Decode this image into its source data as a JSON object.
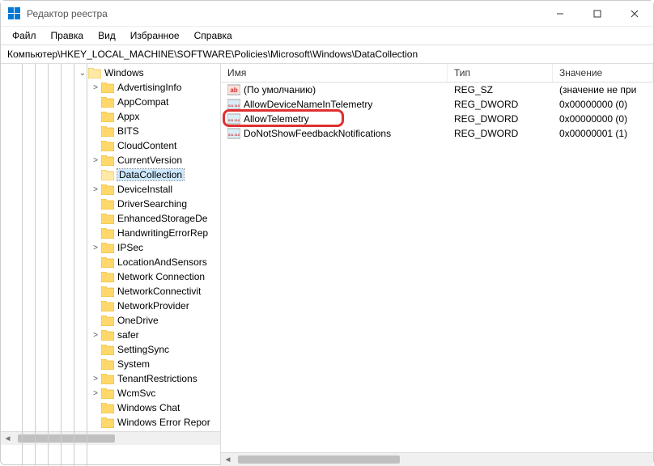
{
  "window": {
    "title": "Редактор реестра"
  },
  "menu": {
    "file": "Файл",
    "edit": "Правка",
    "view": "Вид",
    "favorites": "Избранное",
    "help": "Справка"
  },
  "address": {
    "path": "Компьютер\\HKEY_LOCAL_MACHINE\\SOFTWARE\\Policies\\Microsoft\\Windows\\DataCollection"
  },
  "tree": {
    "parent": {
      "label": "Windows",
      "expanded": true
    },
    "items": [
      {
        "label": "AdvertisingInfo",
        "chev": ">"
      },
      {
        "label": "AppCompat",
        "chev": ""
      },
      {
        "label": "Appx",
        "chev": ""
      },
      {
        "label": "BITS",
        "chev": ""
      },
      {
        "label": "CloudContent",
        "chev": ""
      },
      {
        "label": "CurrentVersion",
        "chev": ">"
      },
      {
        "label": "DataCollection",
        "chev": "",
        "selected": true
      },
      {
        "label": "DeviceInstall",
        "chev": ">"
      },
      {
        "label": "DriverSearching",
        "chev": ""
      },
      {
        "label": "EnhancedStorageDe",
        "chev": ""
      },
      {
        "label": "HandwritingErrorRep",
        "chev": ""
      },
      {
        "label": "IPSec",
        "chev": ">"
      },
      {
        "label": "LocationAndSensors",
        "chev": ""
      },
      {
        "label": "Network Connection",
        "chev": ""
      },
      {
        "label": "NetworkConnectivit",
        "chev": ""
      },
      {
        "label": "NetworkProvider",
        "chev": ""
      },
      {
        "label": "OneDrive",
        "chev": ""
      },
      {
        "label": "safer",
        "chev": ">"
      },
      {
        "label": "SettingSync",
        "chev": ""
      },
      {
        "label": "System",
        "chev": ""
      },
      {
        "label": "TenantRestrictions",
        "chev": ">"
      },
      {
        "label": "WcmSvc",
        "chev": ">"
      },
      {
        "label": "Windows Chat",
        "chev": ""
      },
      {
        "label": "Windows Error Repor",
        "chev": ""
      }
    ]
  },
  "list": {
    "headers": {
      "name": "Имя",
      "type": "Тип",
      "value": "Значение"
    },
    "rows": [
      {
        "icon": "string",
        "name": "(По умолчанию)",
        "type": "REG_SZ",
        "value": "(значение не при"
      },
      {
        "icon": "dword",
        "name": "AllowDeviceNameInTelemetry",
        "type": "REG_DWORD",
        "value": "0x00000000 (0)"
      },
      {
        "icon": "dword",
        "name": "AllowTelemetry",
        "type": "REG_DWORD",
        "value": "0x00000000 (0)",
        "highlight": true
      },
      {
        "icon": "dword",
        "name": "DoNotShowFeedbackNotifications",
        "type": "REG_DWORD",
        "value": "0x00000001 (1)"
      }
    ]
  }
}
